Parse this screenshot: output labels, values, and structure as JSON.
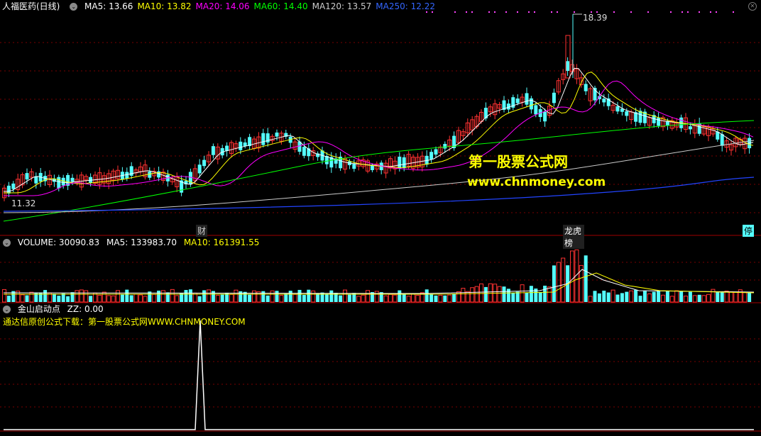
{
  "main": {
    "stock_name": "人福医药(日线)",
    "ma": [
      {
        "label": "MA5: 13.66",
        "color": "#ffffff"
      },
      {
        "label": "MA10: 13.82",
        "color": "#ffff00"
      },
      {
        "label": "MA20: 14.06",
        "color": "#ff00ff"
      },
      {
        "label": "MA60: 14.40",
        "color": "#00ff00"
      },
      {
        "label": "MA120: 13.57",
        "color": "#cccccc"
      },
      {
        "label": "MA250: 12.22",
        "color": "#3366ff"
      }
    ],
    "high_label": "18.39",
    "low_label": "11.32",
    "tags": {
      "cai": "财",
      "bang": "龙虎榜",
      "ting": "停"
    }
  },
  "volume": {
    "title": "VOLUME: 30090.83",
    "ma5": "MA5: 133983.70",
    "ma10": "MA10: 161391.55"
  },
  "indicator": {
    "title": "金山启动点",
    "zz": "ZZ: 0.00",
    "note": "通达信原创公式下载：第一股票公式网WWW.CHNMONEY.COM"
  },
  "watermark": {
    "line1": "第一股票公式网",
    "line2": "www.chnmoney.com"
  },
  "colors": {
    "up": "#ff3232",
    "down": "#54ffff",
    "grid": "#7a0000",
    "bg": "#000000"
  }
}
